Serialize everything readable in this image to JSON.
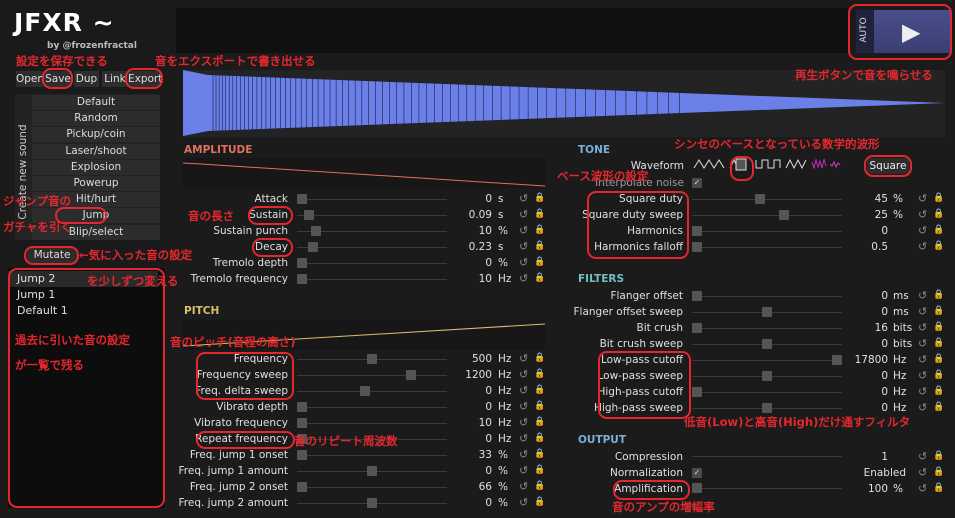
{
  "app": {
    "logo": "JFXR ~",
    "byline": "by @frozenfractal"
  },
  "toolbar": {
    "open": "Open",
    "save": "Save",
    "dup": "Dup",
    "link": "Link",
    "export": "Export"
  },
  "generators": {
    "side_label": "Create new sound",
    "items": [
      "Default",
      "Random",
      "Pickup/coin",
      "Laser/shoot",
      "Explosion",
      "Powerup",
      "Hit/hurt",
      "Jump",
      "Blip/select"
    ]
  },
  "mutate_label": "Mutate",
  "history": [
    "Jump 2",
    "Jump 1",
    "Default 1"
  ],
  "play": {
    "auto_label": "AUTO",
    "play_glyph": "▶"
  },
  "sections": {
    "amplitude": "AMPLITUDE",
    "pitch": "PITCH",
    "tone": "TONE",
    "filters": "FILTERS",
    "output": "OUTPUT"
  },
  "amplitude_rows": [
    {
      "label": "Attack",
      "value": "0",
      "unit": "s",
      "pos": 0.0
    },
    {
      "label": "Sustain",
      "value": "0.09",
      "unit": "s",
      "pos": 0.05
    },
    {
      "label": "Sustain punch",
      "value": "10",
      "unit": "%",
      "pos": 0.1
    },
    {
      "label": "Decay",
      "value": "0.23",
      "unit": "s",
      "pos": 0.08
    },
    {
      "label": "Tremolo depth",
      "value": "0",
      "unit": "%",
      "pos": 0.0
    },
    {
      "label": "Tremolo frequency",
      "value": "10",
      "unit": "Hz",
      "pos": 0.0
    }
  ],
  "pitch_rows": [
    {
      "label": "Frequency",
      "value": "500",
      "unit": "Hz",
      "pos": 0.5
    },
    {
      "label": "Frequency sweep",
      "value": "1200",
      "unit": "Hz",
      "pos": 0.78
    },
    {
      "label": "Freq. delta sweep",
      "value": "0",
      "unit": "Hz",
      "pos": 0.45
    },
    {
      "label": "Vibrato depth",
      "value": "0",
      "unit": "Hz",
      "pos": 0.0
    },
    {
      "label": "Vibrato frequency",
      "value": "10",
      "unit": "Hz",
      "pos": 0.0
    },
    {
      "label": "Repeat frequency",
      "value": "0",
      "unit": "Hz",
      "pos": 0.0
    },
    {
      "label": "Freq. jump 1 onset",
      "value": "33",
      "unit": "%",
      "pos": 0.0
    },
    {
      "label": "Freq. jump 1 amount",
      "value": "0",
      "unit": "%",
      "pos": 0.5
    },
    {
      "label": "Freq. jump 2 onset",
      "value": "66",
      "unit": "%",
      "pos": 0.0
    },
    {
      "label": "Freq. jump 2 amount",
      "value": "0",
      "unit": "%",
      "pos": 0.5
    }
  ],
  "tone": {
    "waveform_label": "Waveform",
    "waveform_value": "Square",
    "interpolate_label": "Interpolate noise",
    "rows": [
      {
        "label": "Square duty",
        "value": "45",
        "unit": "%",
        "pos": 0.45
      },
      {
        "label": "Square duty sweep",
        "value": "25",
        "unit": "%",
        "pos": 0.62
      },
      {
        "label": "Harmonics",
        "value": "0",
        "unit": "",
        "pos": 0.0
      },
      {
        "label": "Harmonics falloff",
        "value": "0.5",
        "unit": "",
        "pos": 0.0
      }
    ]
  },
  "filter_rows": [
    {
      "label": "Flanger offset",
      "value": "0",
      "unit": "ms",
      "pos": 0.0
    },
    {
      "label": "Flanger offset sweep",
      "value": "0",
      "unit": "ms",
      "pos": 0.5
    },
    {
      "label": "Bit crush",
      "value": "16",
      "unit": "bits",
      "pos": 0.0
    },
    {
      "label": "Bit crush sweep",
      "value": "0",
      "unit": "bits",
      "pos": 0.5
    },
    {
      "label": "Low-pass cutoff",
      "value": "17800",
      "unit": "Hz",
      "pos": 1.0
    },
    {
      "label": "Low-pass sweep",
      "value": "0",
      "unit": "Hz",
      "pos": 0.5
    },
    {
      "label": "High-pass cutoff",
      "value": "0",
      "unit": "Hz",
      "pos": 0.0
    },
    {
      "label": "High-pass sweep",
      "value": "0",
      "unit": "Hz",
      "pos": 0.5
    }
  ],
  "output": {
    "compression_label": "Compression",
    "compression_value": "1",
    "normalization_label": "Normalization",
    "normalization_value": "Enabled",
    "amplification_label": "Amplification",
    "amplification_value": "100",
    "amplification_unit": "%"
  },
  "annotations": {
    "save": "設定を保存できる",
    "export": "音をエクスポートで書き出せる",
    "play": "再生ボタンで音を鳴らせる",
    "jump1": "ジャンプ音の",
    "jump2": "ガチャを引く",
    "mutate1": "←気に入った音の設定",
    "mutate2": "を少しずつ変える",
    "history1": "過去に引いた音の設定",
    "history2": "が一覧で残る",
    "sustain": "音の長さ",
    "pitch": "音のピッチ(音程の高さ)",
    "repeat": "音のリピート周波数",
    "waveform": "シンセのベースとなっている数学的波形",
    "wavetype": "ベース波形の設定",
    "filter": "低音(Low)と高音(High)だけ通すフィルタ",
    "amp": "音のアンプの増幅率"
  },
  "colors": {
    "section_red": "#e07060",
    "section_yellow": "#d8c06c",
    "section_blue": "#7ab0d8",
    "section_teal": "#70c0c0",
    "wave_blue": "#6b7fe8",
    "annotation_red": "#e4272e"
  }
}
